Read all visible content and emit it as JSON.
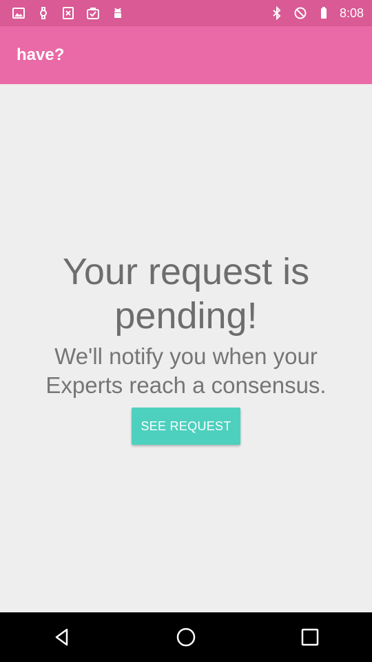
{
  "status_bar": {
    "time": "8:08",
    "left_icons": [
      "image-icon",
      "watch-icon",
      "close-box-icon",
      "check-bag-icon",
      "android-icon"
    ],
    "right_icons": [
      "bluetooth-icon",
      "do-not-disturb-icon",
      "battery-icon"
    ],
    "color": "#d95a94"
  },
  "app_bar": {
    "title": "have?",
    "color": "#e96aa6"
  },
  "main": {
    "title": "Your request is pending!",
    "message": "We'll notify you when your Experts reach a consensus.",
    "button_label": "SEE REQUEST",
    "button_color": "#4dd0be"
  },
  "nav_bar": {
    "buttons": [
      "back-icon",
      "home-icon",
      "recents-icon"
    ]
  }
}
